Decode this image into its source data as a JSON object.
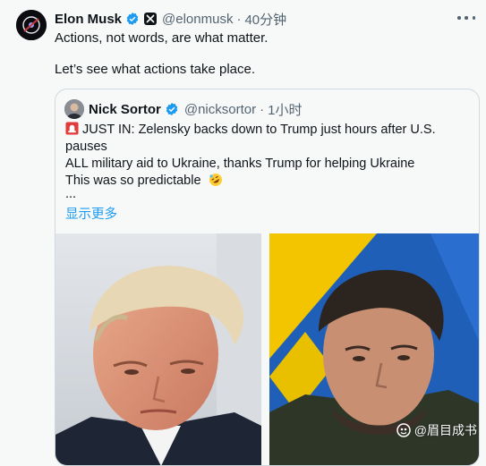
{
  "tweet": {
    "author_name": "Elon Musk",
    "author_handle": "@elonmusk",
    "time": "40分钟",
    "separator": "·",
    "lines": [
      "Actions, not words, are what matter.",
      "Let’s see what actions take place."
    ]
  },
  "quote": {
    "author_name": "Nick Sortor",
    "author_handle": "@nicksortor",
    "separator": "·",
    "time": "1小时",
    "body_line1": "JUST IN: Zelensky backs down to Trump just hours after U.S. pauses",
    "body_line2": "ALL military aid to Ukraine, thanks Trump for helping Ukraine",
    "predictable": "This was so predictable",
    "ellipsis": "...",
    "show_more": "显示更多"
  },
  "watermark": {
    "text": "@眉目成书"
  },
  "colors": {
    "link": "#1d9bf0",
    "secondary_text": "#536471",
    "verified": "#1d9bf0",
    "background": "#f7f9f9"
  },
  "icons": {
    "verified": "verified-badge-icon",
    "affiliate": "x-logo-icon",
    "more": "more-horizontal-icon",
    "siren": "rotating-light-icon",
    "laugh": "rofl-emoji-icon"
  }
}
